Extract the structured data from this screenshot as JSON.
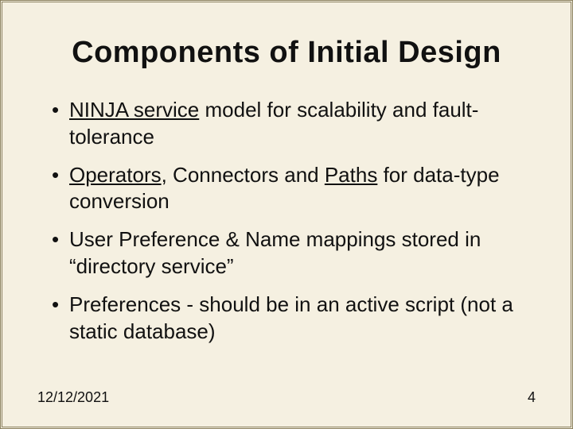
{
  "title": "Components of Initial Design",
  "bullets": [
    {
      "pre": "",
      "u1": "NINJA service",
      "mid": " model for scalability and fault-tolerance",
      "u2": "",
      "post": ""
    },
    {
      "pre": "",
      "u1": "Operators",
      "mid": ", Connectors and ",
      "u2": "Paths",
      "post": " for data-type conversion"
    },
    {
      "pre": "User Preference & Name mappings stored in “directory service”",
      "u1": "",
      "mid": "",
      "u2": "",
      "post": ""
    },
    {
      "pre": "Preferences - should be in an active script (not a static database)",
      "u1": "",
      "mid": "",
      "u2": "",
      "post": ""
    }
  ],
  "footer": {
    "date": "12/12/2021",
    "page": "4"
  }
}
